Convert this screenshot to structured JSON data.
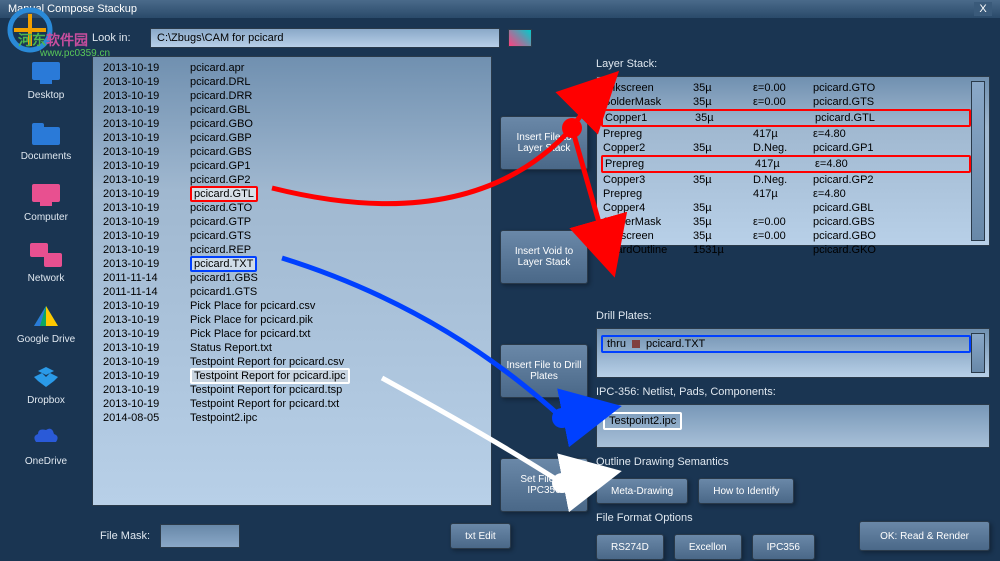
{
  "title": "Manual Compose Stackup",
  "lookin_label": "Look in:",
  "lookin_path": "C:\\Zbugs\\CAM for pcicard",
  "sidebar": [
    {
      "label": "Desktop"
    },
    {
      "label": "Documents"
    },
    {
      "label": "Computer"
    },
    {
      "label": "Network"
    },
    {
      "label": "Google Drive"
    },
    {
      "label": "Dropbox"
    },
    {
      "label": "OneDrive"
    }
  ],
  "files": [
    {
      "d": "2013-10-19",
      "n": "pcicard.apr"
    },
    {
      "d": "2013-10-19",
      "n": "pcicard.DRL"
    },
    {
      "d": "2013-10-19",
      "n": "pcicard.DRR"
    },
    {
      "d": "2013-10-19",
      "n": "pcicard.GBL"
    },
    {
      "d": "2013-10-19",
      "n": "pcicard.GBO"
    },
    {
      "d": "2013-10-19",
      "n": "pcicard.GBP"
    },
    {
      "d": "2013-10-19",
      "n": "pcicard.GBS"
    },
    {
      "d": "2013-10-19",
      "n": "pcicard.GP1"
    },
    {
      "d": "2013-10-19",
      "n": "pcicard.GP2"
    },
    {
      "d": "2013-10-19",
      "n": "pcicard.GTL",
      "hl": "red"
    },
    {
      "d": "2013-10-19",
      "n": "pcicard.GTO"
    },
    {
      "d": "2013-10-19",
      "n": "pcicard.GTP"
    },
    {
      "d": "2013-10-19",
      "n": "pcicard.GTS"
    },
    {
      "d": "2013-10-19",
      "n": "pcicard.REP"
    },
    {
      "d": "2013-10-19",
      "n": "pcicard.TXT",
      "hl": "blue"
    },
    {
      "d": "2011-11-14",
      "n": "pcicard1.GBS"
    },
    {
      "d": "2011-11-14",
      "n": "pcicard1.GTS"
    },
    {
      "d": "2013-10-19",
      "n": "Pick Place for pcicard.csv"
    },
    {
      "d": "2013-10-19",
      "n": "Pick Place for pcicard.pik"
    },
    {
      "d": "2013-10-19",
      "n": "Pick Place for pcicard.txt"
    },
    {
      "d": "2013-10-19",
      "n": "Status Report.txt"
    },
    {
      "d": "2013-10-19",
      "n": "Testpoint Report for pcicard.csv"
    },
    {
      "d": "2013-10-19",
      "n": "Testpoint Report for pcicard.ipc",
      "hl": "white"
    },
    {
      "d": "2013-10-19",
      "n": "Testpoint Report for pcicard.tsp"
    },
    {
      "d": "2013-10-19",
      "n": "Testpoint Report for pcicard.txt"
    },
    {
      "d": "2014-08-05",
      "n": "Testpoint2.ipc"
    }
  ],
  "mid_buttons": {
    "b1": "Insert File to Layer Stack",
    "b2": "Insert Void to Layer Stack",
    "b3": "Insert File to Drill Plates",
    "b4": "Set File as IPC356"
  },
  "layer_stack_label": "Layer Stack:",
  "layers": [
    {
      "c1": "Silkscreen",
      "c2": "35µ",
      "c3": "ε=0.00",
      "c4": "pcicard.GTO"
    },
    {
      "c1": "SolderMask",
      "c2": "35µ",
      "c3": "ε=0.00",
      "c4": "pcicard.GTS"
    },
    {
      "c1": "Copper1",
      "c2": "35µ",
      "c3": "",
      "c4": "pcicard.GTL",
      "hl": true
    },
    {
      "c1": "Prepreg",
      "c2": "",
      "c3": "417µ",
      "c4": "ε=4.80"
    },
    {
      "c1": "Copper2",
      "c2": "35µ",
      "c3": "D.Neg.",
      "c4": "pcicard.GP1"
    },
    {
      "c1": "Prepreg",
      "c2": "",
      "c3": "417µ",
      "c4": "ε=4.80",
      "hl": true
    },
    {
      "c1": "Copper3",
      "c2": "35µ",
      "c3": "D.Neg.",
      "c4": "pcicard.GP2"
    },
    {
      "c1": "Prepreg",
      "c2": "",
      "c3": "417µ",
      "c4": "ε=4.80"
    },
    {
      "c1": "Copper4",
      "c2": "35µ",
      "c3": "",
      "c4": "pcicard.GBL"
    },
    {
      "c1": "SolderMask",
      "c2": "35µ",
      "c3": "ε=0.00",
      "c4": "pcicard.GBS"
    },
    {
      "c1": "Silkscreen",
      "c2": "35µ",
      "c3": "ε=0.00",
      "c4": "pcicard.GBO"
    },
    {
      "c1": "BoardOutline",
      "c2": "1531µ",
      "c3": "",
      "c4": "pcicard.GKO"
    }
  ],
  "drill_label": "Drill Plates:",
  "drill_thru": "thru",
  "drill_file": "pcicard.TXT",
  "ipc_label": "IPC-356: Netlist, Pads, Components:",
  "ipc_value": "Testpoint2.ipc",
  "outline_label": "Outline Drawing Semantics",
  "meta_btn": "Meta-Drawing",
  "howto_btn": "How to Identify",
  "format_label": "File Format Options",
  "rs274d_btn": "RS274D",
  "excellon_btn": "Excellon",
  "ipc356_btn": "IPC356",
  "mask_label": "File Mask:",
  "txtedit_btn": "txt Edit",
  "ok_btn": "OK: Read & Render",
  "watermark": {
    "a": "河东",
    "b": "软件园",
    "url": "www.pc0359.cn"
  }
}
